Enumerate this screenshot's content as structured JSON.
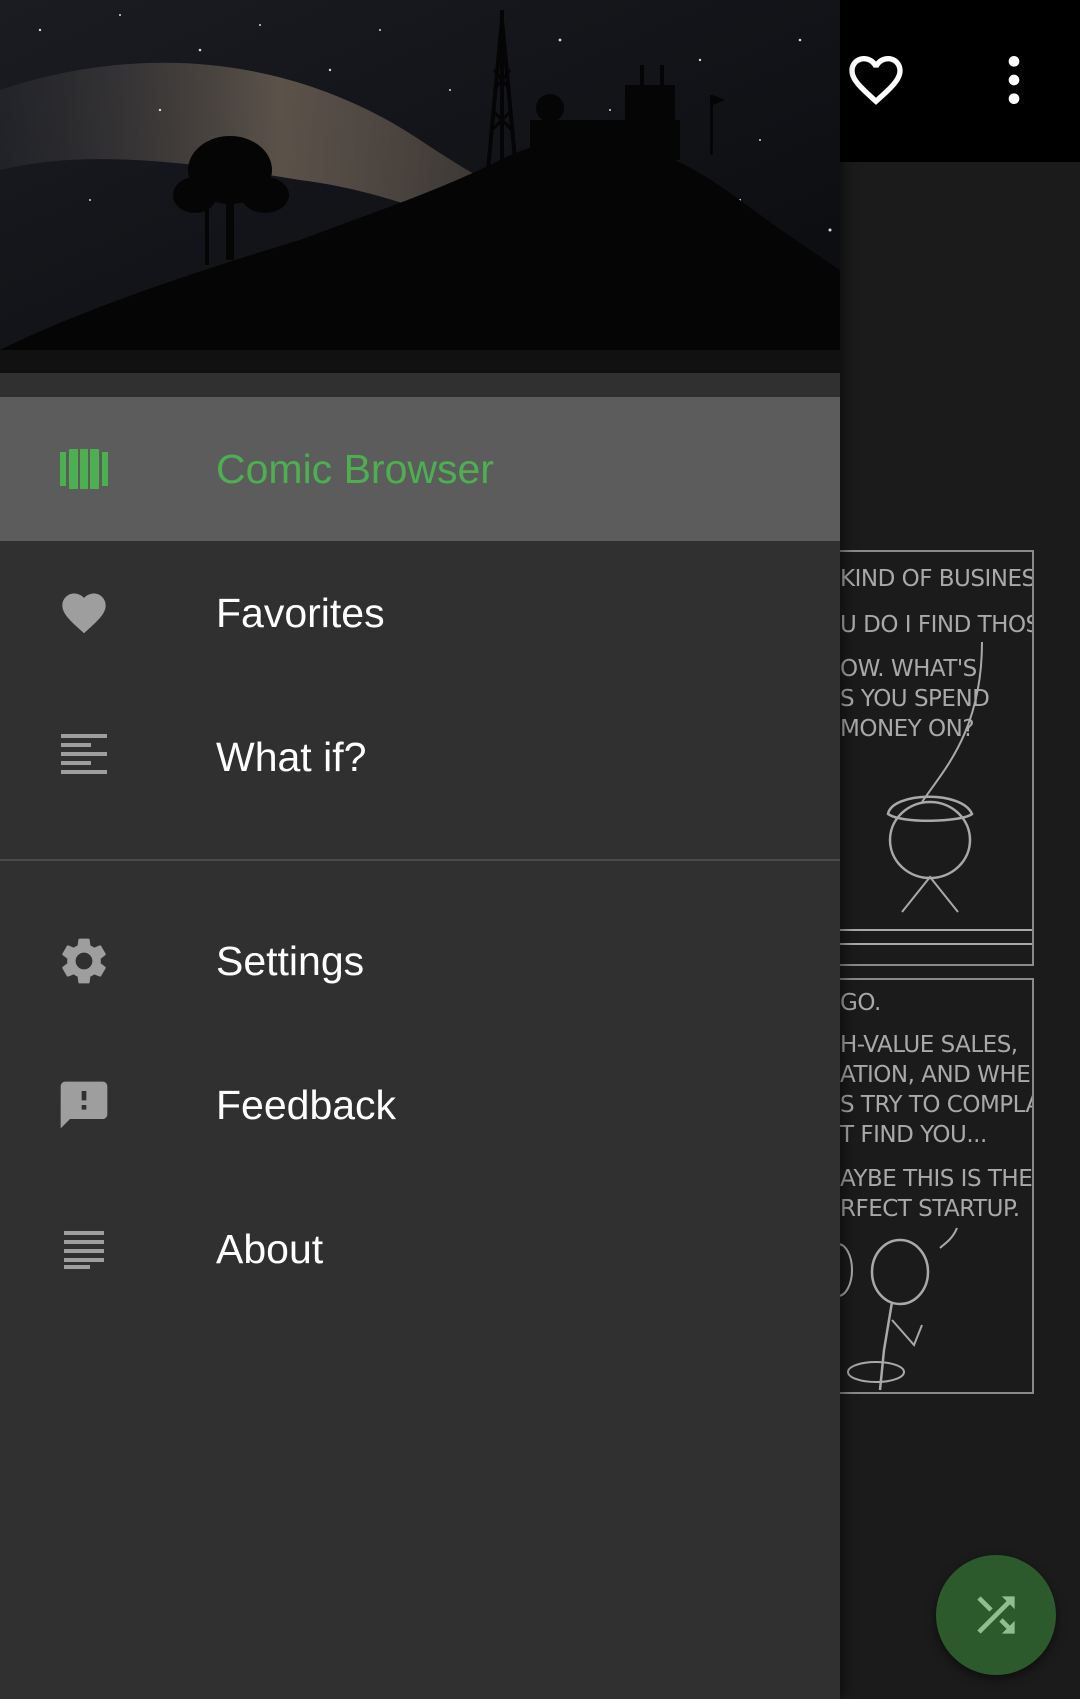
{
  "colors": {
    "accent": "#4caf50",
    "drawer_bg": "#303030",
    "active_item_bg": "#5c5c5c",
    "icon_gray": "#9e9e9e",
    "toolbar_bg": "#000000",
    "fab_bg": "#2c5a2c"
  },
  "toolbar": {
    "icons": [
      "heart-outline-icon",
      "more-vert-icon"
    ]
  },
  "drawer": {
    "header_image": "night-sky-milky-way-hill-silhouette",
    "primary_items": [
      {
        "label": "Comic Browser",
        "icon": "comic-browser-icon",
        "active": true
      },
      {
        "label": "Favorites",
        "icon": "heart-icon",
        "active": false
      },
      {
        "label": "What if?",
        "icon": "article-lines-icon",
        "active": false
      }
    ],
    "secondary_items": [
      {
        "label": "Settings",
        "icon": "gear-icon"
      },
      {
        "label": "Feedback",
        "icon": "feedback-icon"
      },
      {
        "label": "About",
        "icon": "notes-icon"
      }
    ]
  },
  "comic": {
    "panel_1": [
      "KIND OF BUSINESS.",
      "U DO I FIND THOSE?",
      "OW. WHAT'S",
      "S YOU SPEND",
      "MONEY ON?"
    ],
    "panel_2": [
      "GO.",
      "H-VALUE SALES,",
      "ATION, AND WHEN",
      "S TRY TO COMPLAIN,",
      "T FIND YOU...",
      "AYBE THIS IS THE",
      "RFECT STARTUP."
    ]
  },
  "fab": {
    "icon": "shuffle-icon"
  }
}
